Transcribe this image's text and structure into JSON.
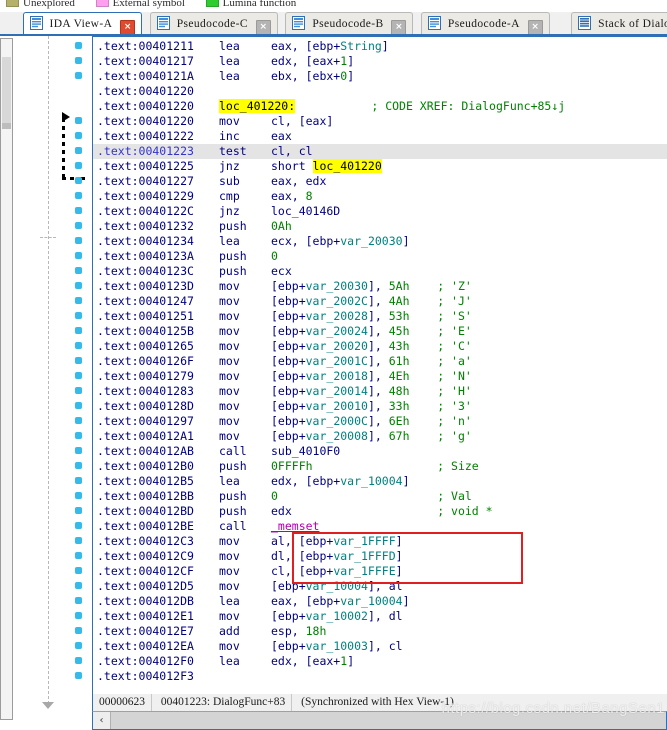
{
  "legend": {
    "items": [
      {
        "label": "Unexplored",
        "color": "#bfb martin"
      },
      {
        "label": "External symbol",
        "color": "#ff9ff0"
      },
      {
        "label": "Lumina function",
        "color": "#2ecc2e"
      }
    ]
  },
  "tabs": [
    {
      "label": "IDA View-A",
      "icon": "document-icon",
      "active": true,
      "close": "×"
    },
    {
      "label": "Pseudocode-C",
      "icon": "document-icon",
      "active": false,
      "close": "×"
    },
    {
      "label": "Pseudocode-B",
      "icon": "document-icon",
      "active": false,
      "close": "×"
    },
    {
      "label": "Pseudocode-A",
      "icon": "document-icon",
      "active": false,
      "close": "×"
    },
    {
      "label": "Stack of DialogF",
      "icon": "stack-icon",
      "active": false,
      "close": ""
    }
  ],
  "disassembly": {
    "segment": ".text",
    "rows": [
      {
        "addr": ".text:00401211",
        "mnem": "lea",
        "ops": [
          {
            "t": "reg",
            "v": "eax, ["
          },
          {
            "t": "reg",
            "v": "ebp+"
          },
          {
            "t": "var",
            "v": "String"
          },
          {
            "t": "reg",
            "v": "]"
          }
        ],
        "dot": true
      },
      {
        "addr": ".text:00401217",
        "mnem": "lea",
        "ops": [
          {
            "t": "reg",
            "v": "edx, [eax+"
          },
          {
            "t": "num",
            "v": "1"
          },
          {
            "t": "reg",
            "v": "]"
          }
        ],
        "dot": true
      },
      {
        "addr": ".text:0040121A",
        "mnem": "lea",
        "ops": [
          {
            "t": "reg",
            "v": "ebx, [ebx+"
          },
          {
            "t": "num",
            "v": "0"
          },
          {
            "t": "reg",
            "v": "]"
          }
        ],
        "dot": true
      },
      {
        "addr": ".text:00401220",
        "mnem": "",
        "ops": [],
        "dot": false
      },
      {
        "addr": ".text:00401220",
        "label": "loc_401220:",
        "mnem": "",
        "ops": [],
        "comment": "; CODE XREF: DialogFunc+85↓j",
        "dot": false
      },
      {
        "addr": ".text:00401220",
        "mnem": "mov",
        "ops": [
          {
            "t": "reg",
            "v": "cl, [eax]"
          }
        ],
        "dot": true
      },
      {
        "addr": ".text:00401222",
        "mnem": "inc",
        "ops": [
          {
            "t": "reg",
            "v": "eax"
          }
        ],
        "dot": true
      },
      {
        "addr": ".text:00401223",
        "mnem": "test",
        "ops": [
          {
            "t": "reg",
            "v": "cl, cl"
          }
        ],
        "dot": true,
        "cursor": true
      },
      {
        "addr": ".text:00401225",
        "mnem": "jnz",
        "ops": [
          {
            "t": "reg",
            "v": "short "
          },
          {
            "t": "hl",
            "v": "loc_401220"
          }
        ],
        "dot": true
      },
      {
        "addr": ".text:00401227",
        "mnem": "sub",
        "ops": [
          {
            "t": "reg",
            "v": "eax, edx"
          }
        ],
        "dot": true
      },
      {
        "addr": ".text:00401229",
        "mnem": "cmp",
        "ops": [
          {
            "t": "reg",
            "v": "eax, "
          },
          {
            "t": "num",
            "v": "8"
          }
        ],
        "dot": true
      },
      {
        "addr": ".text:0040122C",
        "mnem": "jnz",
        "ops": [
          {
            "t": "loc",
            "v": "loc_40146D"
          }
        ],
        "dot": true
      },
      {
        "addr": ".text:00401232",
        "mnem": "push",
        "ops": [
          {
            "t": "num",
            "v": "0Ah"
          }
        ],
        "dot": true
      },
      {
        "addr": ".text:00401234",
        "mnem": "lea",
        "ops": [
          {
            "t": "reg",
            "v": "ecx, [ebp+"
          },
          {
            "t": "var",
            "v": "var_20030"
          },
          {
            "t": "reg",
            "v": "]"
          }
        ],
        "dot": true
      },
      {
        "addr": ".text:0040123A",
        "mnem": "push",
        "ops": [
          {
            "t": "num",
            "v": "0"
          }
        ],
        "dot": true
      },
      {
        "addr": ".text:0040123C",
        "mnem": "push",
        "ops": [
          {
            "t": "reg",
            "v": "ecx"
          }
        ],
        "dot": true
      },
      {
        "addr": ".text:0040123D",
        "mnem": "mov",
        "ops": [
          {
            "t": "reg",
            "v": "[ebp+"
          },
          {
            "t": "var",
            "v": "var_20030"
          },
          {
            "t": "reg",
            "v": "], "
          },
          {
            "t": "num",
            "v": "5Ah"
          }
        ],
        "comment": "; 'Z'",
        "dot": true
      },
      {
        "addr": ".text:00401247",
        "mnem": "mov",
        "ops": [
          {
            "t": "reg",
            "v": "[ebp+"
          },
          {
            "t": "var",
            "v": "var_2002C"
          },
          {
            "t": "reg",
            "v": "], "
          },
          {
            "t": "num",
            "v": "4Ah"
          }
        ],
        "comment": "; 'J'",
        "dot": true
      },
      {
        "addr": ".text:00401251",
        "mnem": "mov",
        "ops": [
          {
            "t": "reg",
            "v": "[ebp+"
          },
          {
            "t": "var",
            "v": "var_20028"
          },
          {
            "t": "reg",
            "v": "], "
          },
          {
            "t": "num",
            "v": "53h"
          }
        ],
        "comment": "; 'S'",
        "dot": true
      },
      {
        "addr": ".text:0040125B",
        "mnem": "mov",
        "ops": [
          {
            "t": "reg",
            "v": "[ebp+"
          },
          {
            "t": "var",
            "v": "var_20024"
          },
          {
            "t": "reg",
            "v": "], "
          },
          {
            "t": "num",
            "v": "45h"
          }
        ],
        "comment": "; 'E'",
        "dot": true
      },
      {
        "addr": ".text:00401265",
        "mnem": "mov",
        "ops": [
          {
            "t": "reg",
            "v": "[ebp+"
          },
          {
            "t": "var",
            "v": "var_20020"
          },
          {
            "t": "reg",
            "v": "], "
          },
          {
            "t": "num",
            "v": "43h"
          }
        ],
        "comment": "; 'C'",
        "dot": true
      },
      {
        "addr": ".text:0040126F",
        "mnem": "mov",
        "ops": [
          {
            "t": "reg",
            "v": "[ebp+"
          },
          {
            "t": "var",
            "v": "var_2001C"
          },
          {
            "t": "reg",
            "v": "], "
          },
          {
            "t": "num",
            "v": "61h"
          }
        ],
        "comment": "; 'a'",
        "dot": true
      },
      {
        "addr": ".text:00401279",
        "mnem": "mov",
        "ops": [
          {
            "t": "reg",
            "v": "[ebp+"
          },
          {
            "t": "var",
            "v": "var_20018"
          },
          {
            "t": "reg",
            "v": "], "
          },
          {
            "t": "num",
            "v": "4Eh"
          }
        ],
        "comment": "; 'N'",
        "dot": true
      },
      {
        "addr": ".text:00401283",
        "mnem": "mov",
        "ops": [
          {
            "t": "reg",
            "v": "[ebp+"
          },
          {
            "t": "var",
            "v": "var_20014"
          },
          {
            "t": "reg",
            "v": "], "
          },
          {
            "t": "num",
            "v": "48h"
          }
        ],
        "comment": "; 'H'",
        "dot": true
      },
      {
        "addr": ".text:0040128D",
        "mnem": "mov",
        "ops": [
          {
            "t": "reg",
            "v": "[ebp+"
          },
          {
            "t": "var",
            "v": "var_20010"
          },
          {
            "t": "reg",
            "v": "], "
          },
          {
            "t": "num",
            "v": "33h"
          }
        ],
        "comment": "; '3'",
        "dot": true
      },
      {
        "addr": ".text:00401297",
        "mnem": "mov",
        "ops": [
          {
            "t": "reg",
            "v": "[ebp+"
          },
          {
            "t": "var",
            "v": "var_2000C"
          },
          {
            "t": "reg",
            "v": "], "
          },
          {
            "t": "num",
            "v": "6Eh"
          }
        ],
        "comment": "; 'n'",
        "dot": true
      },
      {
        "addr": ".text:004012A1",
        "mnem": "mov",
        "ops": [
          {
            "t": "reg",
            "v": "[ebp+"
          },
          {
            "t": "var",
            "v": "var_20008"
          },
          {
            "t": "reg",
            "v": "], "
          },
          {
            "t": "num",
            "v": "67h"
          }
        ],
        "comment": "; 'g'",
        "dot": true
      },
      {
        "addr": ".text:004012AB",
        "mnem": "call",
        "ops": [
          {
            "t": "sub",
            "v": "sub_4010F0"
          }
        ],
        "dot": true
      },
      {
        "addr": ".text:004012B0",
        "mnem": "push",
        "ops": [
          {
            "t": "num",
            "v": "0FFFFh"
          }
        ],
        "comment": "; Size",
        "dot": true
      },
      {
        "addr": ".text:004012B5",
        "mnem": "lea",
        "ops": [
          {
            "t": "reg",
            "v": "edx, [ebp+"
          },
          {
            "t": "var",
            "v": "var_10004"
          },
          {
            "t": "reg",
            "v": "]"
          }
        ],
        "dot": true
      },
      {
        "addr": ".text:004012BB",
        "mnem": "push",
        "ops": [
          {
            "t": "num",
            "v": "0"
          }
        ],
        "comment": "; Val",
        "dot": true
      },
      {
        "addr": ".text:004012BD",
        "mnem": "push",
        "ops": [
          {
            "t": "reg",
            "v": "edx"
          }
        ],
        "comment": "; void *",
        "dot": true
      },
      {
        "addr": ".text:004012BE",
        "mnem": "call",
        "ops": [
          {
            "t": "api",
            "v": "_memset"
          }
        ],
        "dot": true
      },
      {
        "addr": ".text:004012C3",
        "mnem": "mov",
        "ops": [
          {
            "t": "reg",
            "v": "al, [ebp+"
          },
          {
            "t": "var",
            "v": "var_1FFFF"
          },
          {
            "t": "reg",
            "v": "]"
          }
        ],
        "dot": true
      },
      {
        "addr": ".text:004012C9",
        "mnem": "mov",
        "ops": [
          {
            "t": "reg",
            "v": "dl, [ebp+"
          },
          {
            "t": "var",
            "v": "var_1FFFD"
          },
          {
            "t": "reg",
            "v": "]"
          }
        ],
        "dot": true
      },
      {
        "addr": ".text:004012CF",
        "mnem": "mov",
        "ops": [
          {
            "t": "reg",
            "v": "cl, [ebp+"
          },
          {
            "t": "var",
            "v": "var_1FFFE"
          },
          {
            "t": "reg",
            "v": "]"
          }
        ],
        "dot": true
      },
      {
        "addr": ".text:004012D5",
        "mnem": "mov",
        "ops": [
          {
            "t": "reg",
            "v": "[ebp+"
          },
          {
            "t": "var",
            "v": "var_10004"
          },
          {
            "t": "reg",
            "v": "], al"
          }
        ],
        "dot": true
      },
      {
        "addr": ".text:004012DB",
        "mnem": "lea",
        "ops": [
          {
            "t": "reg",
            "v": "eax, [ebp+"
          },
          {
            "t": "var",
            "v": "var_10004"
          },
          {
            "t": "reg",
            "v": "]"
          }
        ],
        "dot": true
      },
      {
        "addr": ".text:004012E1",
        "mnem": "mov",
        "ops": [
          {
            "t": "reg",
            "v": "[ebp+"
          },
          {
            "t": "var",
            "v": "var_10002"
          },
          {
            "t": "reg",
            "v": "], dl"
          }
        ],
        "dot": true
      },
      {
        "addr": ".text:004012E7",
        "mnem": "add",
        "ops": [
          {
            "t": "reg",
            "v": "esp, "
          },
          {
            "t": "num",
            "v": "18h"
          }
        ],
        "dot": true
      },
      {
        "addr": ".text:004012EA",
        "mnem": "mov",
        "ops": [
          {
            "t": "reg",
            "v": "[ebp+"
          },
          {
            "t": "var",
            "v": "var_10003"
          },
          {
            "t": "reg",
            "v": "], cl"
          }
        ],
        "dot": true
      },
      {
        "addr": ".text:004012F0",
        "mnem": "lea",
        "ops": [
          {
            "t": "reg",
            "v": "edx, [eax+"
          },
          {
            "t": "num",
            "v": "1"
          },
          {
            "t": "reg",
            "v": "]"
          }
        ],
        "dot": true
      },
      {
        "addr": ".text:004012F3",
        "mnem": "",
        "ops": [],
        "dot": true
      }
    ]
  },
  "statusbar": {
    "offset": "00000623",
    "location": "00401223: DialogFunc+83",
    "sync": "(Synchronized with Hex View-1)"
  },
  "hscroll": {
    "left_arrow": "‹"
  },
  "watermark": "https://blog.csdn.net/BangSen1"
}
